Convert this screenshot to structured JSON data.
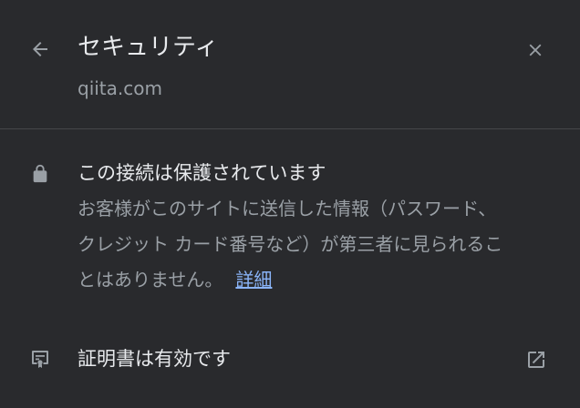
{
  "header": {
    "title": "セキュリティ",
    "site": "qiita.com",
    "back_icon": "back-arrow-icon",
    "close_icon": "close-icon"
  },
  "connection": {
    "icon": "lock-icon",
    "title": "この接続は保護されています",
    "description_lines": [
      "お客様がこのサイトに送信した情報（パスワード、",
      "クレジット カード番号など）が第三者に見られるこ",
      "とはありません。"
    ],
    "details_link": "詳細"
  },
  "certificate": {
    "icon": "certificate-icon",
    "label": "証明書は有効です",
    "external_icon": "open-external-icon"
  },
  "colors": {
    "background": "#292a2d",
    "text_primary": "#e8eaed",
    "text_secondary": "#9aa0a6",
    "link": "#8ab4f8",
    "divider": "#45474a"
  }
}
